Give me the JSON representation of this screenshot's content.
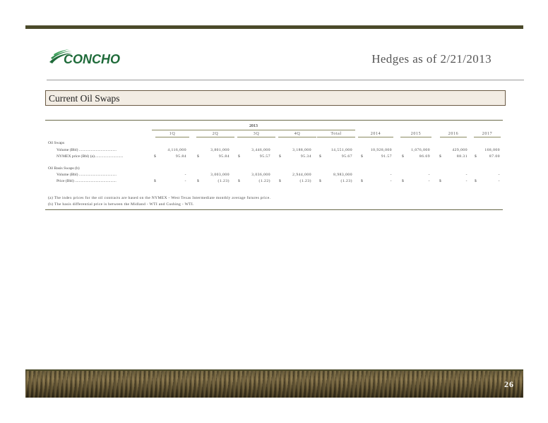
{
  "header": {
    "logo_text": "CONCHO",
    "title": "Hedges as of 2/21/2013"
  },
  "section": {
    "title": "Current Oil Swaps"
  },
  "table": {
    "group_label": "2013",
    "columns": [
      "1Q",
      "2Q",
      "3Q",
      "4Q",
      "Total",
      "2014",
      "2015",
      "2016",
      "2017"
    ],
    "sections": [
      {
        "label": "Oil Swaps",
        "rows": [
          {
            "label": "Volume (Bbl) ......................................",
            "values": [
              "4,116,000",
              "3,801,000",
              "3,446,000",
              "3,188,000",
              "14,551,000",
              "10,928,000",
              "1,076,000",
              "429,000",
              "168,000"
            ],
            "dollar": false
          },
          {
            "label": "NYMEX price (Bbl) (a).............................",
            "values": [
              "95.84",
              "95.84",
              "95.57",
              "95.34",
              "95.67",
              "91.57",
              "86.69",
              "88.31",
              "87.00"
            ],
            "dollar": true
          }
        ]
      },
      {
        "label": "Oil Basis Swaps (b)",
        "rows": [
          {
            "label": "Volume (Bbl) ......................................",
            "values": [
              "-",
              "3,003,000",
              "3,036,000",
              "2,944,000",
              "8,983,000",
              "-",
              "-",
              "-",
              "-"
            ],
            "dollar": false
          },
          {
            "label": "Price (Bbl) ..........................................",
            "values": [
              "-",
              "(1.23)",
              "(1.22)",
              "(1.23)",
              "(1.23)",
              "-",
              "-",
              "-",
              "-"
            ],
            "dollar": true
          }
        ]
      }
    ],
    "currency_symbol": "$"
  },
  "footnotes": [
    "(a)  The index prices for the oil contracts are based on the NYMEX - West Texas Intermediate monthly average futures price.",
    "(b)  The basis differential price is between the Midland - WTI and Cushing - WTI."
  ],
  "footer": {
    "page_number": "26"
  },
  "colors": {
    "logo_green": "#1f6b3a",
    "bar_olive": "#4b4a2a",
    "section_fill": "#f3ede4"
  }
}
